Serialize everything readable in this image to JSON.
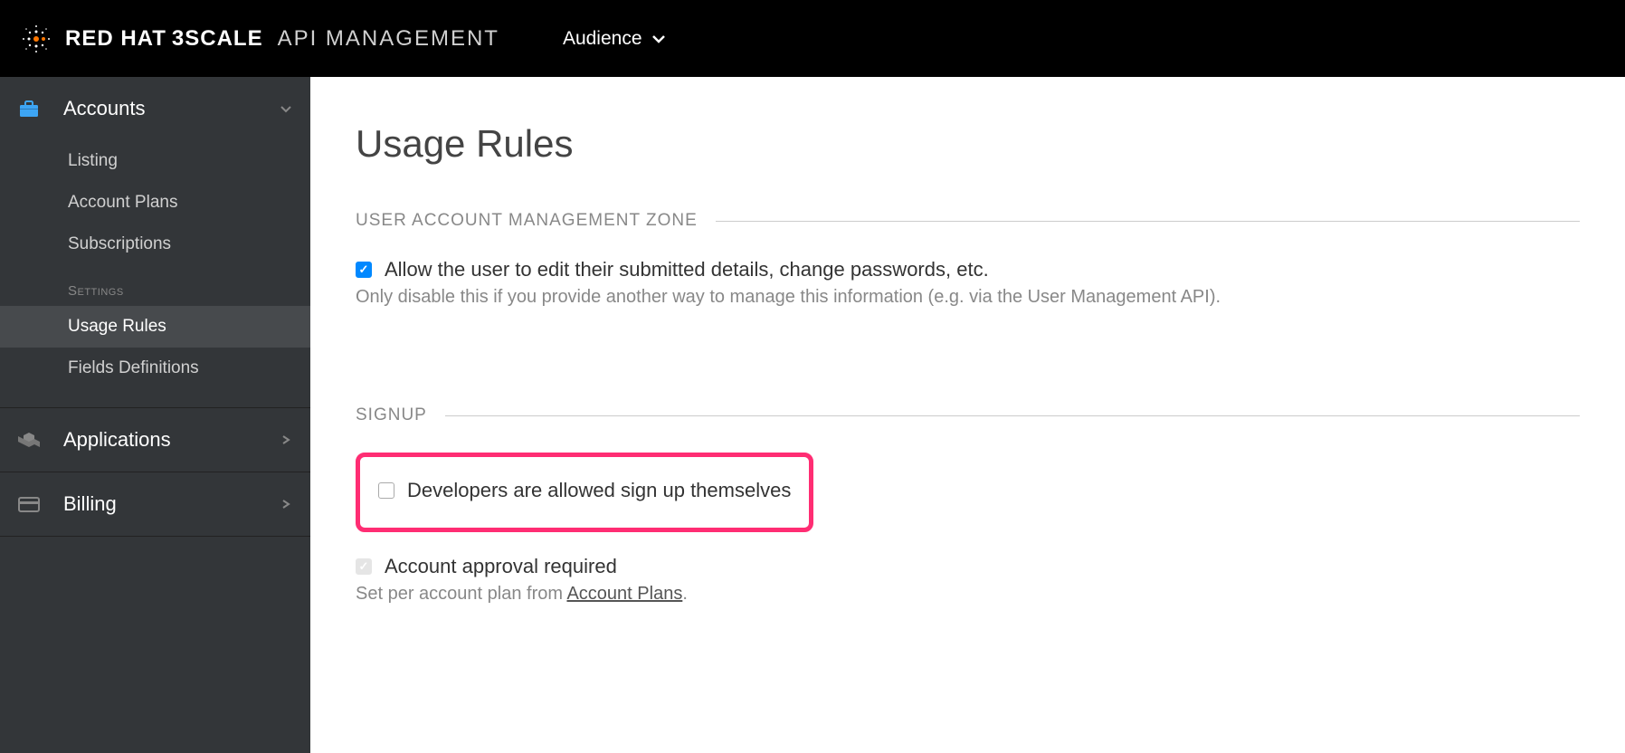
{
  "header": {
    "brand_redhat": "RED HAT",
    "brand_3scale": "3SCALE",
    "brand_api": "API MANAGEMENT",
    "context": "Audience"
  },
  "sidebar": {
    "accounts": {
      "label": "Accounts",
      "items": [
        {
          "label": "Listing"
        },
        {
          "label": "Account Plans"
        },
        {
          "label": "Subscriptions"
        }
      ],
      "settings_label": "Settings",
      "settings_items": [
        {
          "label": "Usage Rules",
          "active": true
        },
        {
          "label": "Fields Definitions"
        }
      ]
    },
    "applications": {
      "label": "Applications"
    },
    "billing": {
      "label": "Billing"
    }
  },
  "main": {
    "title": "Usage Rules",
    "section1": {
      "header": "USER ACCOUNT MANAGEMENT ZONE",
      "field1": {
        "label": "Allow the user to edit their submitted details, change passwords, etc.",
        "help": "Only disable this if you provide another way to manage this information (e.g. via the User Management API)."
      }
    },
    "section2": {
      "header": "SIGNUP",
      "field1": {
        "label": "Developers are allowed sign up themselves"
      },
      "field2": {
        "label": "Account approval required",
        "help_prefix": "Set per account plan from ",
        "help_link": "Account Plans",
        "help_suffix": "."
      }
    }
  }
}
